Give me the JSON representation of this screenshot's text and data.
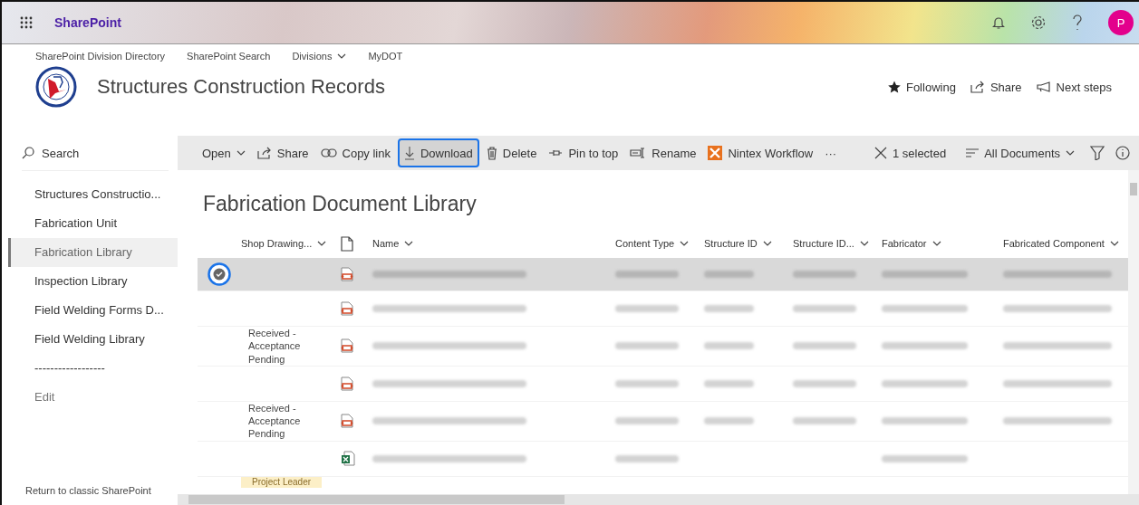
{
  "suite_bar": {
    "app_name": "SharePoint",
    "avatar_initial": "P"
  },
  "hub_nav": [
    {
      "label": "SharePoint Division Directory",
      "has_menu": false
    },
    {
      "label": "SharePoint Search",
      "has_menu": false
    },
    {
      "label": "Divisions",
      "has_menu": true
    },
    {
      "label": "MyDOT",
      "has_menu": false
    }
  ],
  "site": {
    "title": "Structures Construction Records"
  },
  "site_actions": [
    {
      "kind": "following",
      "label": "Following"
    },
    {
      "kind": "share",
      "label": "Share"
    },
    {
      "kind": "next",
      "label": "Next steps"
    }
  ],
  "search": {
    "placeholder": "Search"
  },
  "sidebar": {
    "items": [
      {
        "label": "Structures Constructio...",
        "selected": false
      },
      {
        "label": "Fabrication Unit",
        "selected": false
      },
      {
        "label": "Fabrication Library",
        "selected": true
      },
      {
        "label": "Inspection Library",
        "selected": false
      },
      {
        "label": "Field Welding Forms D...",
        "selected": false
      },
      {
        "label": "Field Welding Library",
        "selected": false
      },
      {
        "label": "------------------",
        "selected": false
      }
    ],
    "edit": "Edit",
    "footer_link": "Return to classic SharePoint"
  },
  "command_bar": [
    {
      "kind": "open",
      "label": "Open",
      "focused": false
    },
    {
      "kind": "share",
      "label": "Share",
      "focused": false
    },
    {
      "kind": "link",
      "label": "Copy link",
      "focused": false
    },
    {
      "kind": "download",
      "label": "Download",
      "focused": true
    },
    {
      "kind": "delete",
      "label": "Delete",
      "focused": false
    },
    {
      "kind": "pin",
      "label": "Pin to top",
      "focused": false
    },
    {
      "kind": "rename",
      "label": "Rename",
      "focused": false
    },
    {
      "kind": "nintex",
      "label": "Nintex Workflow",
      "focused": false
    },
    {
      "kind": "more",
      "label": "···",
      "focused": false
    }
  ],
  "command_right": {
    "selection": "1 selected",
    "view": "All Documents"
  },
  "library": {
    "title": "Fabrication Document Library"
  },
  "table": {
    "columns": [
      "Shop Drawing...",
      "Name",
      "Content Type",
      "Structure ID",
      "Structure ID...",
      "Fabricator",
      "Fabricated Component"
    ],
    "rows": [
      {
        "selected": true,
        "status": "",
        "kind": "pdf",
        "blurred": [
          true,
          true,
          true,
          true,
          true,
          true
        ]
      },
      {
        "selected": false,
        "status": "",
        "kind": "pdf",
        "blurred": [
          true,
          true,
          true,
          true,
          true,
          true
        ]
      },
      {
        "selected": false,
        "status": "Received - Acceptance Pending",
        "kind": "pdf",
        "blurred": [
          true,
          true,
          true,
          true,
          true,
          true
        ]
      },
      {
        "selected": false,
        "status": "",
        "kind": "pdf",
        "blurred": [
          true,
          true,
          true,
          true,
          true,
          true
        ]
      },
      {
        "selected": false,
        "status": "Received - Acceptance Pending",
        "kind": "pdf",
        "blurred": [
          true,
          true,
          true,
          true,
          true,
          true
        ]
      },
      {
        "selected": false,
        "status": "",
        "kind": "xlsx",
        "blurred": [
          true,
          true,
          false,
          false,
          true,
          false
        ]
      }
    ],
    "partial_tag": "Project Leader"
  }
}
